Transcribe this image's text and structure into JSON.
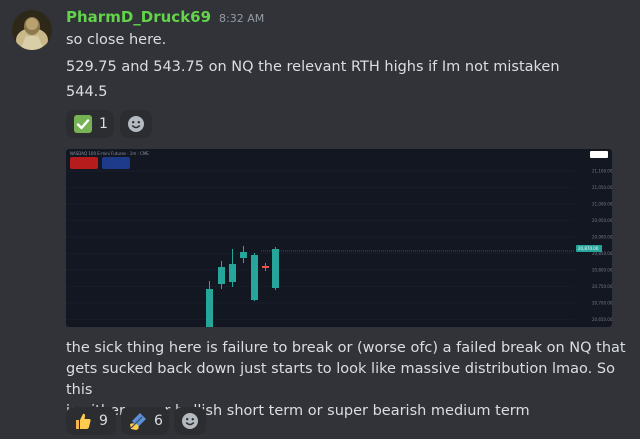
{
  "message1": {
    "username": "PharmD_Druck69",
    "timestamp": "8:32 AM",
    "lines": [
      "so close here.",
      "529.75 and 543.75 on NQ the relevant RTH highs if Im not mistaken",
      "544.5"
    ],
    "reactions": [
      {
        "emoji": "check-mark-icon",
        "count": "1"
      }
    ]
  },
  "embed": {
    "title": "NASDAQ 100 E-mini Futures · 1m · CME",
    "price_ticks": [
      "21,100.00",
      "21,050.00",
      "21,000.00",
      "20,950.00",
      "20,900.00",
      "20,850.00",
      "20,800.00",
      "20,750.00",
      "20,700.00",
      "20,650.00"
    ],
    "current_price": "20,870.00",
    "colors": {
      "up": "#26a69a",
      "down": "#ef5350",
      "background": "#131722"
    }
  },
  "message2": {
    "lines": [
      "the sick thing here is failure to break or (worse ofc) a failed break on NQ that",
      "gets sucked back down just starts to look like massive distribution lmao. So this",
      "is either super bullish short term or super bearish medium term"
    ],
    "reactions": [
      {
        "emoji": "thumbs-up-icon",
        "count": "9"
      },
      {
        "emoji": "writing-hand-icon",
        "count": "6"
      }
    ]
  }
}
